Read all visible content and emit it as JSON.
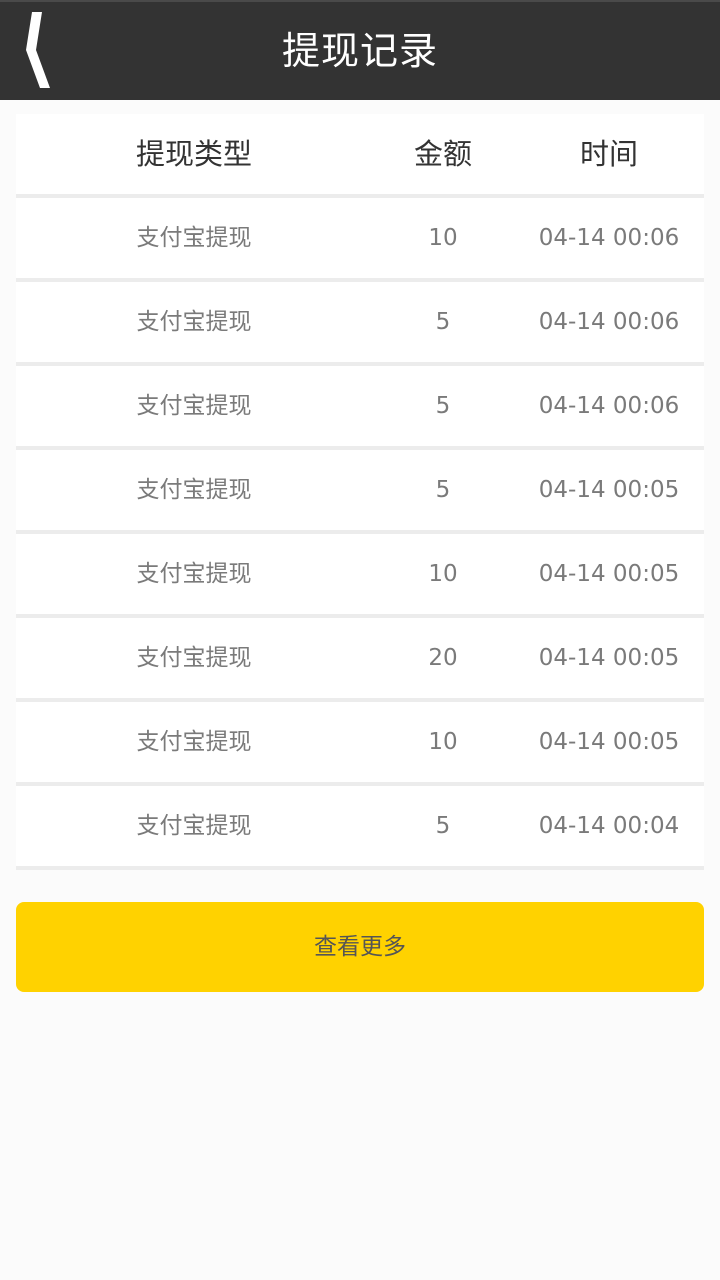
{
  "header": {
    "title": "提现记录",
    "back_icon": "back-chevron-icon"
  },
  "table": {
    "columns": [
      "提现类型",
      "金额",
      "时间"
    ],
    "rows": [
      {
        "type": "支付宝提现",
        "amount": "10",
        "time": "04-14 00:06"
      },
      {
        "type": "支付宝提现",
        "amount": "5",
        "time": "04-14 00:06"
      },
      {
        "type": "支付宝提现",
        "amount": "5",
        "time": "04-14 00:06"
      },
      {
        "type": "支付宝提现",
        "amount": "5",
        "time": "04-14 00:05"
      },
      {
        "type": "支付宝提现",
        "amount": "10",
        "time": "04-14 00:05"
      },
      {
        "type": "支付宝提现",
        "amount": "20",
        "time": "04-14 00:05"
      },
      {
        "type": "支付宝提现",
        "amount": "10",
        "time": "04-14 00:05"
      },
      {
        "type": "支付宝提现",
        "amount": "5",
        "time": "04-14 00:04"
      }
    ]
  },
  "footer": {
    "more_label": "查看更多"
  },
  "colors": {
    "header_bg": "#333333",
    "accent": "#ffd200",
    "page_bg": "#fbfbfb"
  }
}
